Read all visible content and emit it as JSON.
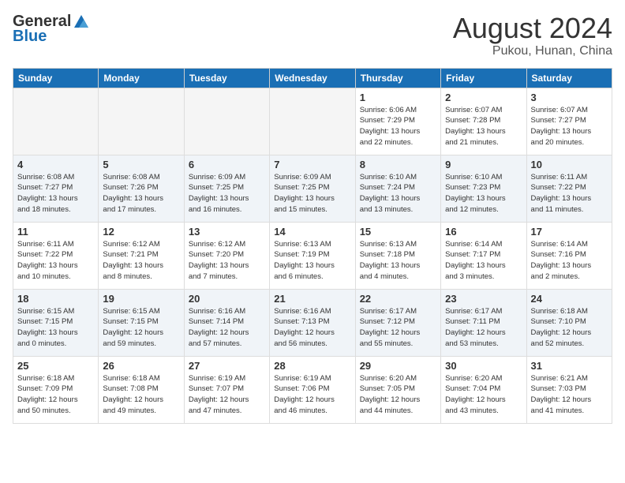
{
  "logo": {
    "general": "General",
    "blue": "Blue"
  },
  "title": "August 2024",
  "location": "Pukou, Hunan, China",
  "weekdays": [
    "Sunday",
    "Monday",
    "Tuesday",
    "Wednesday",
    "Thursday",
    "Friday",
    "Saturday"
  ],
  "weeks": [
    [
      {
        "day": "",
        "info": ""
      },
      {
        "day": "",
        "info": ""
      },
      {
        "day": "",
        "info": ""
      },
      {
        "day": "",
        "info": ""
      },
      {
        "day": "1",
        "info": "Sunrise: 6:06 AM\nSunset: 7:29 PM\nDaylight: 13 hours\nand 22 minutes."
      },
      {
        "day": "2",
        "info": "Sunrise: 6:07 AM\nSunset: 7:28 PM\nDaylight: 13 hours\nand 21 minutes."
      },
      {
        "day": "3",
        "info": "Sunrise: 6:07 AM\nSunset: 7:27 PM\nDaylight: 13 hours\nand 20 minutes."
      }
    ],
    [
      {
        "day": "4",
        "info": "Sunrise: 6:08 AM\nSunset: 7:27 PM\nDaylight: 13 hours\nand 18 minutes."
      },
      {
        "day": "5",
        "info": "Sunrise: 6:08 AM\nSunset: 7:26 PM\nDaylight: 13 hours\nand 17 minutes."
      },
      {
        "day": "6",
        "info": "Sunrise: 6:09 AM\nSunset: 7:25 PM\nDaylight: 13 hours\nand 16 minutes."
      },
      {
        "day": "7",
        "info": "Sunrise: 6:09 AM\nSunset: 7:25 PM\nDaylight: 13 hours\nand 15 minutes."
      },
      {
        "day": "8",
        "info": "Sunrise: 6:10 AM\nSunset: 7:24 PM\nDaylight: 13 hours\nand 13 minutes."
      },
      {
        "day": "9",
        "info": "Sunrise: 6:10 AM\nSunset: 7:23 PM\nDaylight: 13 hours\nand 12 minutes."
      },
      {
        "day": "10",
        "info": "Sunrise: 6:11 AM\nSunset: 7:22 PM\nDaylight: 13 hours\nand 11 minutes."
      }
    ],
    [
      {
        "day": "11",
        "info": "Sunrise: 6:11 AM\nSunset: 7:22 PM\nDaylight: 13 hours\nand 10 minutes."
      },
      {
        "day": "12",
        "info": "Sunrise: 6:12 AM\nSunset: 7:21 PM\nDaylight: 13 hours\nand 8 minutes."
      },
      {
        "day": "13",
        "info": "Sunrise: 6:12 AM\nSunset: 7:20 PM\nDaylight: 13 hours\nand 7 minutes."
      },
      {
        "day": "14",
        "info": "Sunrise: 6:13 AM\nSunset: 7:19 PM\nDaylight: 13 hours\nand 6 minutes."
      },
      {
        "day": "15",
        "info": "Sunrise: 6:13 AM\nSunset: 7:18 PM\nDaylight: 13 hours\nand 4 minutes."
      },
      {
        "day": "16",
        "info": "Sunrise: 6:14 AM\nSunset: 7:17 PM\nDaylight: 13 hours\nand 3 minutes."
      },
      {
        "day": "17",
        "info": "Sunrise: 6:14 AM\nSunset: 7:16 PM\nDaylight: 13 hours\nand 2 minutes."
      }
    ],
    [
      {
        "day": "18",
        "info": "Sunrise: 6:15 AM\nSunset: 7:15 PM\nDaylight: 13 hours\nand 0 minutes."
      },
      {
        "day": "19",
        "info": "Sunrise: 6:15 AM\nSunset: 7:15 PM\nDaylight: 12 hours\nand 59 minutes."
      },
      {
        "day": "20",
        "info": "Sunrise: 6:16 AM\nSunset: 7:14 PM\nDaylight: 12 hours\nand 57 minutes."
      },
      {
        "day": "21",
        "info": "Sunrise: 6:16 AM\nSunset: 7:13 PM\nDaylight: 12 hours\nand 56 minutes."
      },
      {
        "day": "22",
        "info": "Sunrise: 6:17 AM\nSunset: 7:12 PM\nDaylight: 12 hours\nand 55 minutes."
      },
      {
        "day": "23",
        "info": "Sunrise: 6:17 AM\nSunset: 7:11 PM\nDaylight: 12 hours\nand 53 minutes."
      },
      {
        "day": "24",
        "info": "Sunrise: 6:18 AM\nSunset: 7:10 PM\nDaylight: 12 hours\nand 52 minutes."
      }
    ],
    [
      {
        "day": "25",
        "info": "Sunrise: 6:18 AM\nSunset: 7:09 PM\nDaylight: 12 hours\nand 50 minutes."
      },
      {
        "day": "26",
        "info": "Sunrise: 6:18 AM\nSunset: 7:08 PM\nDaylight: 12 hours\nand 49 minutes."
      },
      {
        "day": "27",
        "info": "Sunrise: 6:19 AM\nSunset: 7:07 PM\nDaylight: 12 hours\nand 47 minutes."
      },
      {
        "day": "28",
        "info": "Sunrise: 6:19 AM\nSunset: 7:06 PM\nDaylight: 12 hours\nand 46 minutes."
      },
      {
        "day": "29",
        "info": "Sunrise: 6:20 AM\nSunset: 7:05 PM\nDaylight: 12 hours\nand 44 minutes."
      },
      {
        "day": "30",
        "info": "Sunrise: 6:20 AM\nSunset: 7:04 PM\nDaylight: 12 hours\nand 43 minutes."
      },
      {
        "day": "31",
        "info": "Sunrise: 6:21 AM\nSunset: 7:03 PM\nDaylight: 12 hours\nand 41 minutes."
      }
    ]
  ]
}
